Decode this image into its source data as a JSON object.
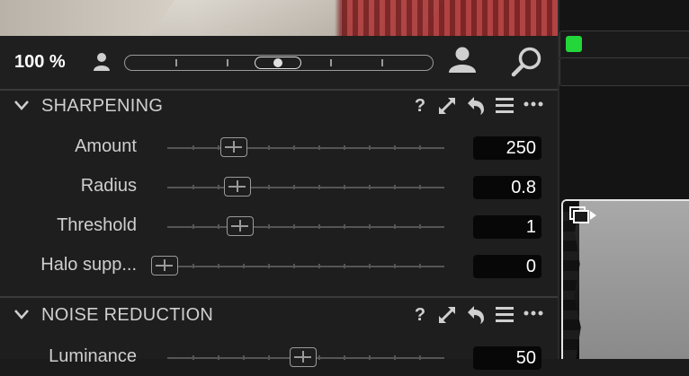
{
  "zoom": {
    "value": "100 %",
    "slider_fraction": 0.5,
    "icons": [
      "person-small-icon",
      "person-large-icon",
      "search-icon"
    ]
  },
  "sections": [
    {
      "title": "SHARPENING",
      "tools": [
        "help-icon",
        "expand-icon",
        "reset-icon",
        "menu-icon",
        "more-icon"
      ],
      "help_label": "?",
      "sliders": [
        {
          "label": "Amount",
          "value": "250",
          "position": 0.24
        },
        {
          "label": "Radius",
          "value": "0.8",
          "position": 0.25
        },
        {
          "label": "Threshold",
          "value": "1",
          "position": 0.26
        },
        {
          "label": "Halo supp...",
          "value": "0",
          "position": 0.0
        }
      ]
    },
    {
      "title": "NOISE REDUCTION",
      "tools": [
        "help-icon",
        "expand-icon",
        "reset-icon",
        "menu-icon",
        "more-icon"
      ],
      "help_label": "?",
      "sliders": [
        {
          "label": "Luminance",
          "value": "50",
          "position": 0.49
        }
      ]
    }
  ],
  "colors": {
    "panel_bg": "#1e1e1e",
    "value_bg": "#070707",
    "color_tag": "#23d63a"
  }
}
